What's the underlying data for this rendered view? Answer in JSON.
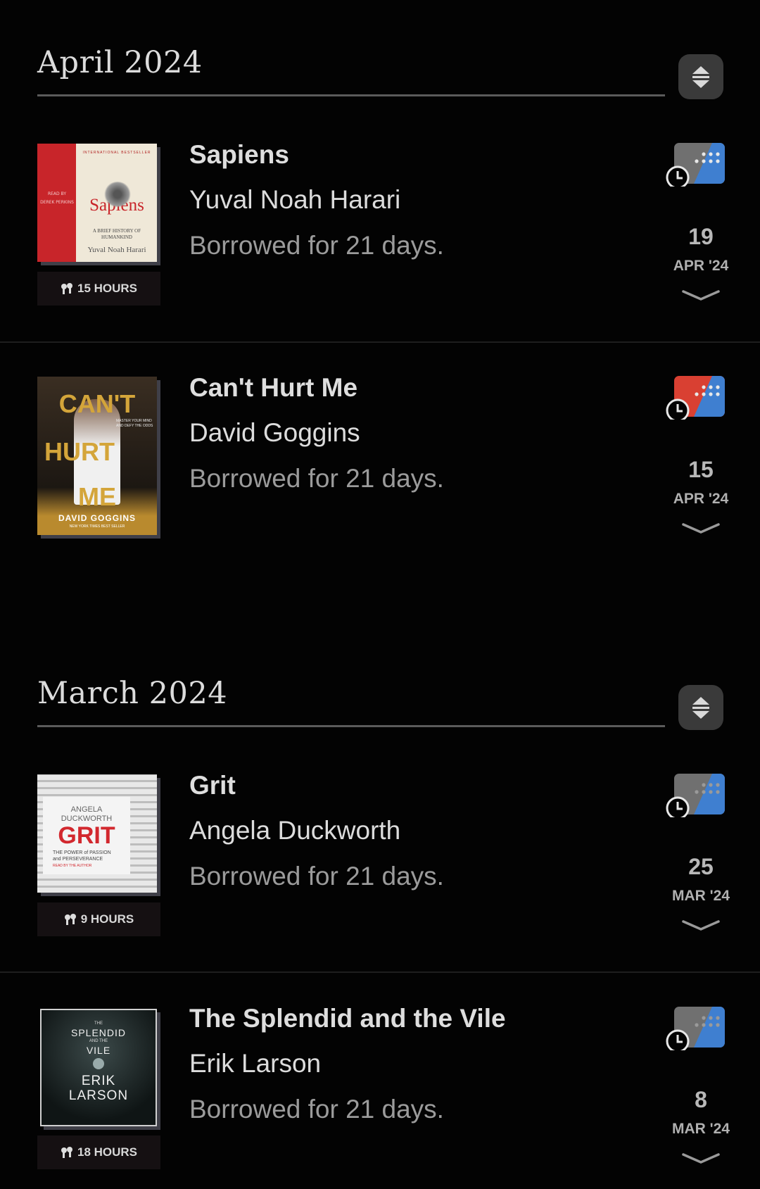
{
  "sections": [
    {
      "title": "April 2024",
      "items": [
        {
          "title": "Sapiens",
          "author": "Yuval Noah Harari",
          "status": "Borrowed for 21 days.",
          "duration": "15 HOURS",
          "day": "19",
          "month": "APR '24",
          "format_colors": [
            "#707070",
            "#3f7fd0"
          ],
          "cover": {
            "top_small": "INTERNATIONAL BESTSELLER",
            "side": "READ BY DEREK PERKINS",
            "title": "Sapiens",
            "subtitle": "A BRIEF HISTORY OF HUMANKIND",
            "author": "Yuval Noah Harari"
          }
        },
        {
          "title": "Can't Hurt Me",
          "author": "David Goggins",
          "status": "Borrowed for 21 days.",
          "duration": "",
          "day": "15",
          "month": "APR '24",
          "format_colors": [
            "#d94032",
            "#3f7fd0"
          ],
          "cover": {
            "title_top": "CAN'T",
            "title_mid": "HURT",
            "title_bot": "ME",
            "tagline": "MASTER YOUR MIND AND DEFY THE ODDS",
            "author": "DAVID GOGGINS",
            "footer": "NEW YORK TIMES BEST SELLER"
          }
        }
      ]
    },
    {
      "title": "March 2024",
      "items": [
        {
          "title": "Grit",
          "author": "Angela Duckworth",
          "status": "Borrowed for 21 days.",
          "duration": "9 HOURS",
          "day": "25",
          "month": "MAR '24",
          "format_colors": [
            "#707070",
            "#3f7fd0"
          ],
          "cover": {
            "author_top": "ANGELA",
            "author_bot": "DUCKWORTH",
            "title": "GRIT",
            "subtitle_1": "THE POWER of PASSION",
            "subtitle_2": "and PERSEVERANCE",
            "footer": "READ BY THE AUTHOR"
          }
        },
        {
          "title": "The Splendid and the Vile",
          "author": "Erik Larson",
          "status": "Borrowed for 21 days.",
          "duration": "18 HOURS",
          "day": "8",
          "month": "MAR '24",
          "format_colors": [
            "#707070",
            "#3f7fd0"
          ],
          "cover": {
            "top": "THE",
            "title_1": "SPLENDID",
            "mid": "AND THE",
            "title_2": "VILE",
            "author_1": "ERIK",
            "author_2": "LARSON"
          }
        }
      ]
    }
  ]
}
